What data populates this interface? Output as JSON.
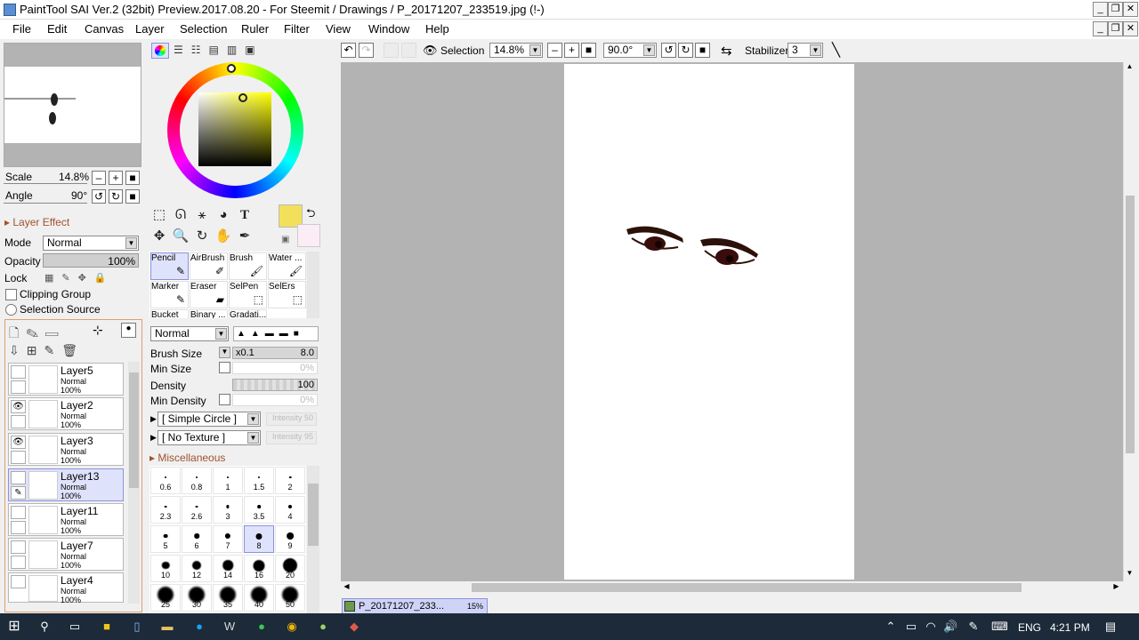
{
  "window": {
    "title": "PaintTool SAI Ver.2 (32bit) Preview.2017.08.20 - For Steemit / Drawings / P_20171207_233519.jpg (!-)",
    "min": "_",
    "max": "❐",
    "close": "✕"
  },
  "menu": [
    "File",
    "Edit",
    "Canvas",
    "Layer",
    "Selection",
    "Ruler",
    "Filter",
    "View",
    "Window",
    "Help"
  ],
  "navigator": {
    "scale_label": "Scale",
    "scale_value": "14.8%",
    "angle_label": "Angle",
    "angle_value": "90°"
  },
  "layer_panel": {
    "effect_label": "Layer Effect",
    "mode_label": "Mode",
    "mode_value": "Normal",
    "opacity_label": "Opacity",
    "opacity_value": "100%",
    "lock_label": "Lock",
    "clipping_label": "Clipping Group",
    "selection_source_label": "Selection Source",
    "layers": [
      {
        "name": "Layer5",
        "mode": "Normal",
        "opacity": "100%"
      },
      {
        "name": "Layer2",
        "mode": "Normal",
        "opacity": "100%"
      },
      {
        "name": "Layer3",
        "mode": "Normal",
        "opacity": "100%"
      },
      {
        "name": "Layer13",
        "mode": "Normal",
        "opacity": "100%"
      },
      {
        "name": "Layer11",
        "mode": "Normal",
        "opacity": "100%"
      },
      {
        "name": "Layer7",
        "mode": "Normal",
        "opacity": "100%"
      },
      {
        "name": "Layer4",
        "mode": "Normal",
        "opacity": "100%"
      }
    ]
  },
  "colors": {
    "primary": "#f2e05a",
    "secondary": "#fcecf6",
    "selected_hue": "#ffff00"
  },
  "brushes": [
    {
      "name": "Pencil"
    },
    {
      "name": "AirBrush"
    },
    {
      "name": "Brush"
    },
    {
      "name": "Water ..."
    },
    {
      "name": "Marker"
    },
    {
      "name": "Eraser"
    },
    {
      "name": "SelPen"
    },
    {
      "name": "SelErs"
    },
    {
      "name": "Bucket"
    },
    {
      "name": "Binary ..."
    },
    {
      "name": "Gradati..."
    }
  ],
  "brush_settings": {
    "blend_mode": "Normal",
    "brush_size_label": "Brush Size",
    "brush_size_mult": "x0.1",
    "brush_size_value": "8.0",
    "min_size_label": "Min Size",
    "min_size_value": "0%",
    "density_label": "Density",
    "density_value": "100",
    "min_density_label": "Min Density",
    "min_density_value": "0%",
    "shape_value": "[ Simple Circle ]",
    "shape_intensity": "Intensity 50",
    "texture_value": "[ No Texture ]",
    "texture_intensity": "Intensity 95",
    "misc_label": "Miscellaneous"
  },
  "size_presets": [
    "0.6",
    "0.8",
    "1",
    "1.5",
    "2",
    "2.3",
    "2.6",
    "3",
    "3.5",
    "4",
    "5",
    "6",
    "7",
    "8",
    "9",
    "10",
    "12",
    "14",
    "16",
    "20",
    "25",
    "30",
    "35",
    "40",
    "50"
  ],
  "canvas_toolbar": {
    "selection_label": "Selection",
    "zoom_value": "14.8%",
    "rotation_value": "90.0°",
    "stabilizer_label": "Stabilizer",
    "stabilizer_value": "3"
  },
  "doc_tab": {
    "name": "P_20171207_233...",
    "zoom": "15%"
  },
  "taskbar": {
    "lang": "ENG",
    "time": "4:21 PM"
  }
}
